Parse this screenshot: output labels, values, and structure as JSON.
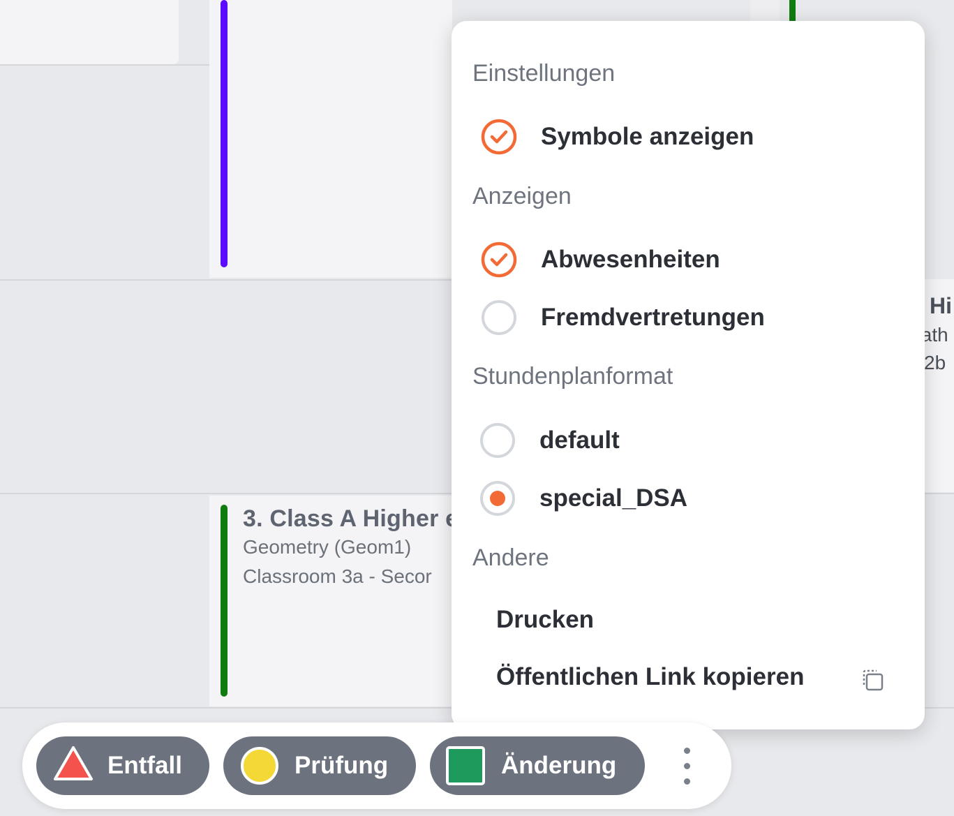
{
  "colors": {
    "accent_orange": "#f26a35",
    "lesson_bar_purple": "#5b0cff",
    "lesson_bar_green": "#107c10",
    "pill_gray": "#6c737e",
    "entfall_red": "#f4524d",
    "pruefung_yellow": "#f4d835",
    "aenderung_green": "#1e9a5c"
  },
  "timetable": {
    "lesson": {
      "title": "3. Class A Higher e",
      "subject": "Geometry (Geom1)",
      "room": "Classroom 3a - Secor"
    },
    "right_card": {
      "title": "Hi",
      "subject": "ıath",
      "room": "2b"
    }
  },
  "menu": {
    "settings": {
      "title": "Einstellungen",
      "items": [
        {
          "label": "Symbole anzeigen",
          "checked": true,
          "icon": "check-circle-icon"
        }
      ]
    },
    "display": {
      "title": "Anzeigen",
      "items": [
        {
          "label": "Abwesenheiten",
          "checked": true,
          "icon": "check-circle-icon"
        },
        {
          "label": "Fremdvertretungen",
          "checked": false,
          "icon": "empty-circle-icon"
        }
      ]
    },
    "format": {
      "title": "Stundenplanformat",
      "items": [
        {
          "label": "default",
          "selected": false,
          "icon": "radio-icon"
        },
        {
          "label": "special_DSA",
          "selected": true,
          "icon": "radio-icon"
        }
      ]
    },
    "other": {
      "title": "Andere",
      "items": [
        {
          "label": "Drucken"
        },
        {
          "label": "Öffentlichen Link kopieren",
          "icon": "copy-icon"
        }
      ]
    }
  },
  "legend": {
    "items": [
      {
        "label": "Entfall",
        "icon": "red-triangle-icon"
      },
      {
        "label": "Prüfung",
        "icon": "yellow-circle-icon"
      },
      {
        "label": "Änderung",
        "icon": "green-square-icon"
      }
    ],
    "more_icon": "kebab-menu-icon"
  }
}
